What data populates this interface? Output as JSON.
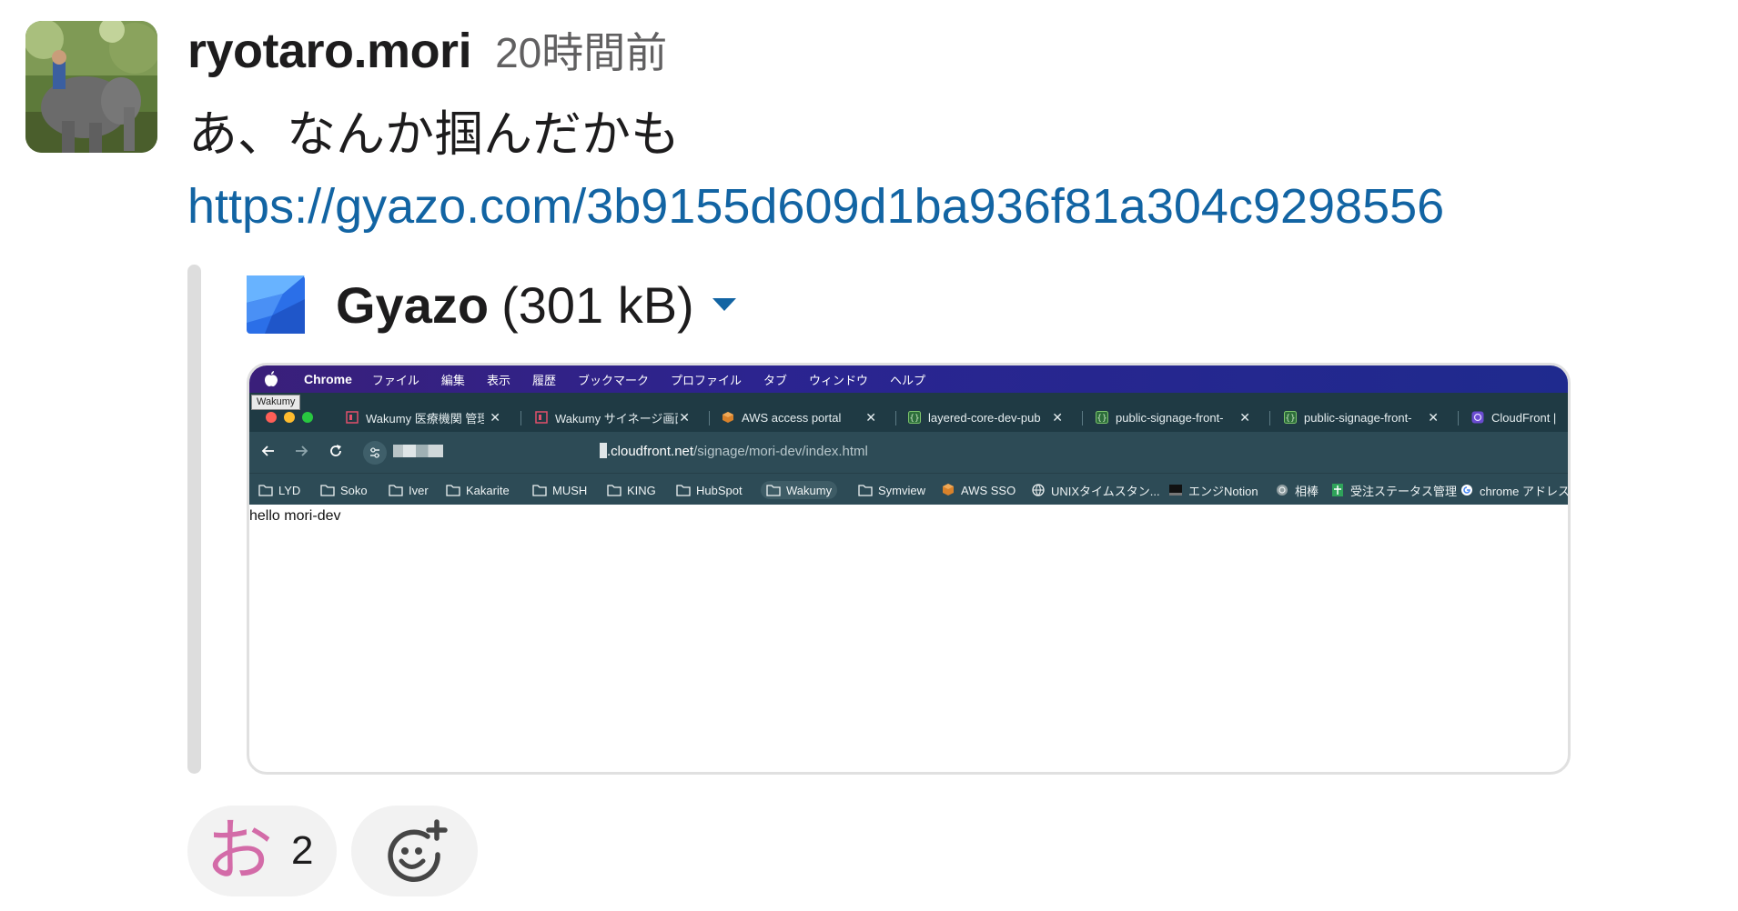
{
  "message": {
    "username": "ryotaro.mori",
    "timestamp": "20時間前",
    "text": "あ、なんか掴んだかも",
    "link": "https://gyazo.com/3b9155d609d1ba936f81a304c9298556"
  },
  "attachment": {
    "title": "Gyazo",
    "size": "(301 kB)",
    "icon": "gyazo-logo"
  },
  "screenshot": {
    "menubar": [
      "Chrome",
      "ファイル",
      "編集",
      "表示",
      "履歴",
      "ブックマーク",
      "プロファイル",
      "タブ",
      "ウィンドウ",
      "ヘルプ"
    ],
    "tooltip": "Wakumy",
    "tabs": [
      {
        "label": "Wakumy 医療機関 管理",
        "icon": "wakumy-icon"
      },
      {
        "label": "Wakumy サイネージ画面",
        "icon": "wakumy-icon"
      },
      {
        "label": "AWS access portal",
        "icon": "aws-cube-icon"
      },
      {
        "label": "layered-core-dev-pub",
        "icon": "code-icon"
      },
      {
        "label": "public-signage-front-",
        "icon": "code-icon"
      },
      {
        "label": "public-signage-front-",
        "icon": "code-icon"
      },
      {
        "label": "CloudFront | ",
        "icon": "cloudfront-icon"
      }
    ],
    "url_host": ".cloudfront.net",
    "url_path": "/signage/mori-dev/index.html",
    "bookmarks": [
      {
        "label": "LYD",
        "icon": "folder-icon"
      },
      {
        "label": "Soko",
        "icon": "folder-icon"
      },
      {
        "label": "Iver",
        "icon": "folder-icon"
      },
      {
        "label": "Kakarite",
        "icon": "folder-icon"
      },
      {
        "label": "MUSH",
        "icon": "folder-icon"
      },
      {
        "label": "KING",
        "icon": "folder-icon"
      },
      {
        "label": "HubSpot",
        "icon": "folder-icon"
      },
      {
        "label": "Wakumy",
        "icon": "folder-icon"
      },
      {
        "label": "Symview",
        "icon": "folder-icon"
      },
      {
        "label": "AWS SSO",
        "icon": "aws-cube-icon"
      },
      {
        "label": "UNIXタイムスタン...",
        "icon": "globe-icon"
      },
      {
        "label": "エンジNotion",
        "icon": "terminal-icon"
      },
      {
        "label": "相棒",
        "icon": "openai-icon"
      },
      {
        "label": "受注ステータス管理",
        "icon": "sheets-icon"
      },
      {
        "label": "chrome アドレス",
        "icon": "google-icon"
      }
    ],
    "page_text": "hello mori-dev"
  },
  "reactions": [
    {
      "emoji": "お",
      "count": "2"
    }
  ],
  "colors": {
    "link": "#1264a3",
    "reaction_emoji": "#d36ba8",
    "browser_toolbar": "#2d4b56"
  }
}
